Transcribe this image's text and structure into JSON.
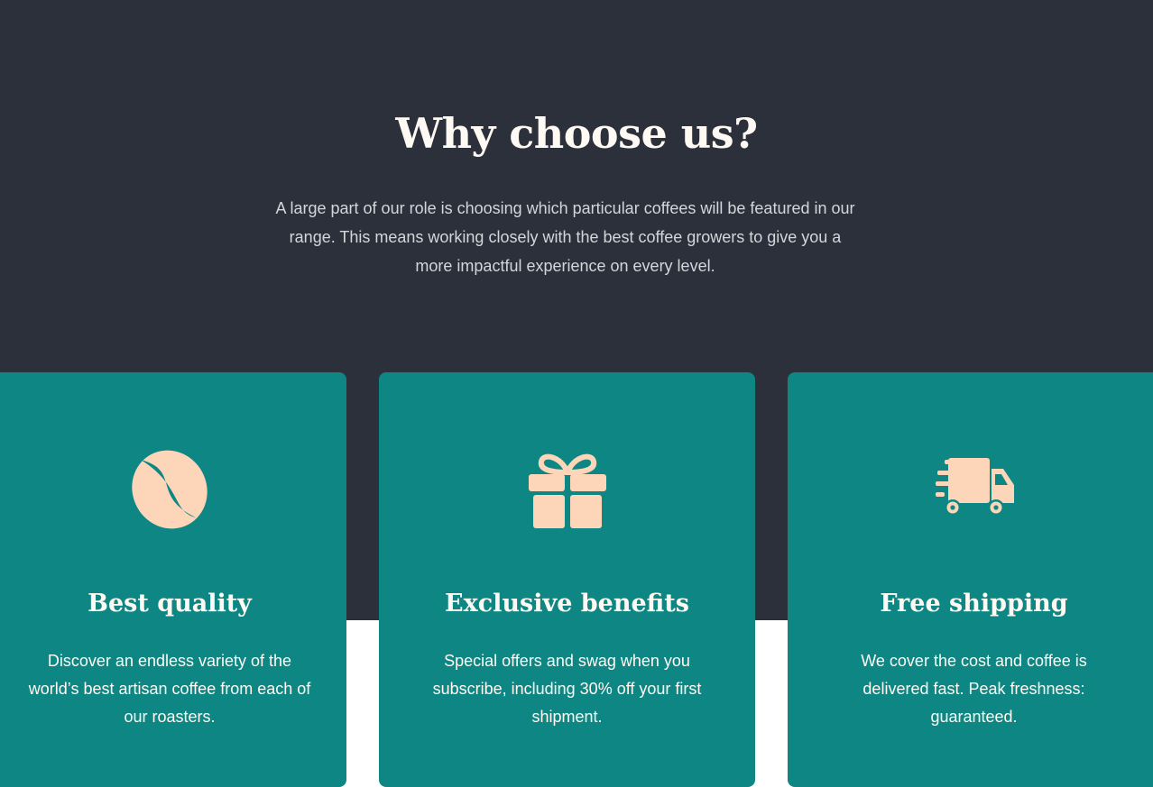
{
  "section": {
    "heading": "Why choose us?",
    "intro": "A large part of our role is choosing which particular coffees will be featured in our range. This means working closely with the best coffee growers to give you a more impactful experience on every level."
  },
  "cards": [
    {
      "icon": "coffee-bean-icon",
      "title": "Best quality",
      "text": "Discover an endless variety of the world’s best artisan coffee from each of our roasters."
    },
    {
      "icon": "gift-icon",
      "title": "Exclusive benefits",
      "text": "Special offers and swag when you subscribe, including 30% off your first shipment."
    },
    {
      "icon": "delivery-truck-icon",
      "title": "Free shipping",
      "text": "We cover the cost and coffee is delivered fast. Peak freshness: guaranteed."
    }
  ],
  "colors": {
    "background_dark": "#2b303b",
    "card": "#0e8784",
    "icon": "#fdd6ba",
    "text_light": "#fef9f3",
    "text_muted": "#d4d6da"
  }
}
